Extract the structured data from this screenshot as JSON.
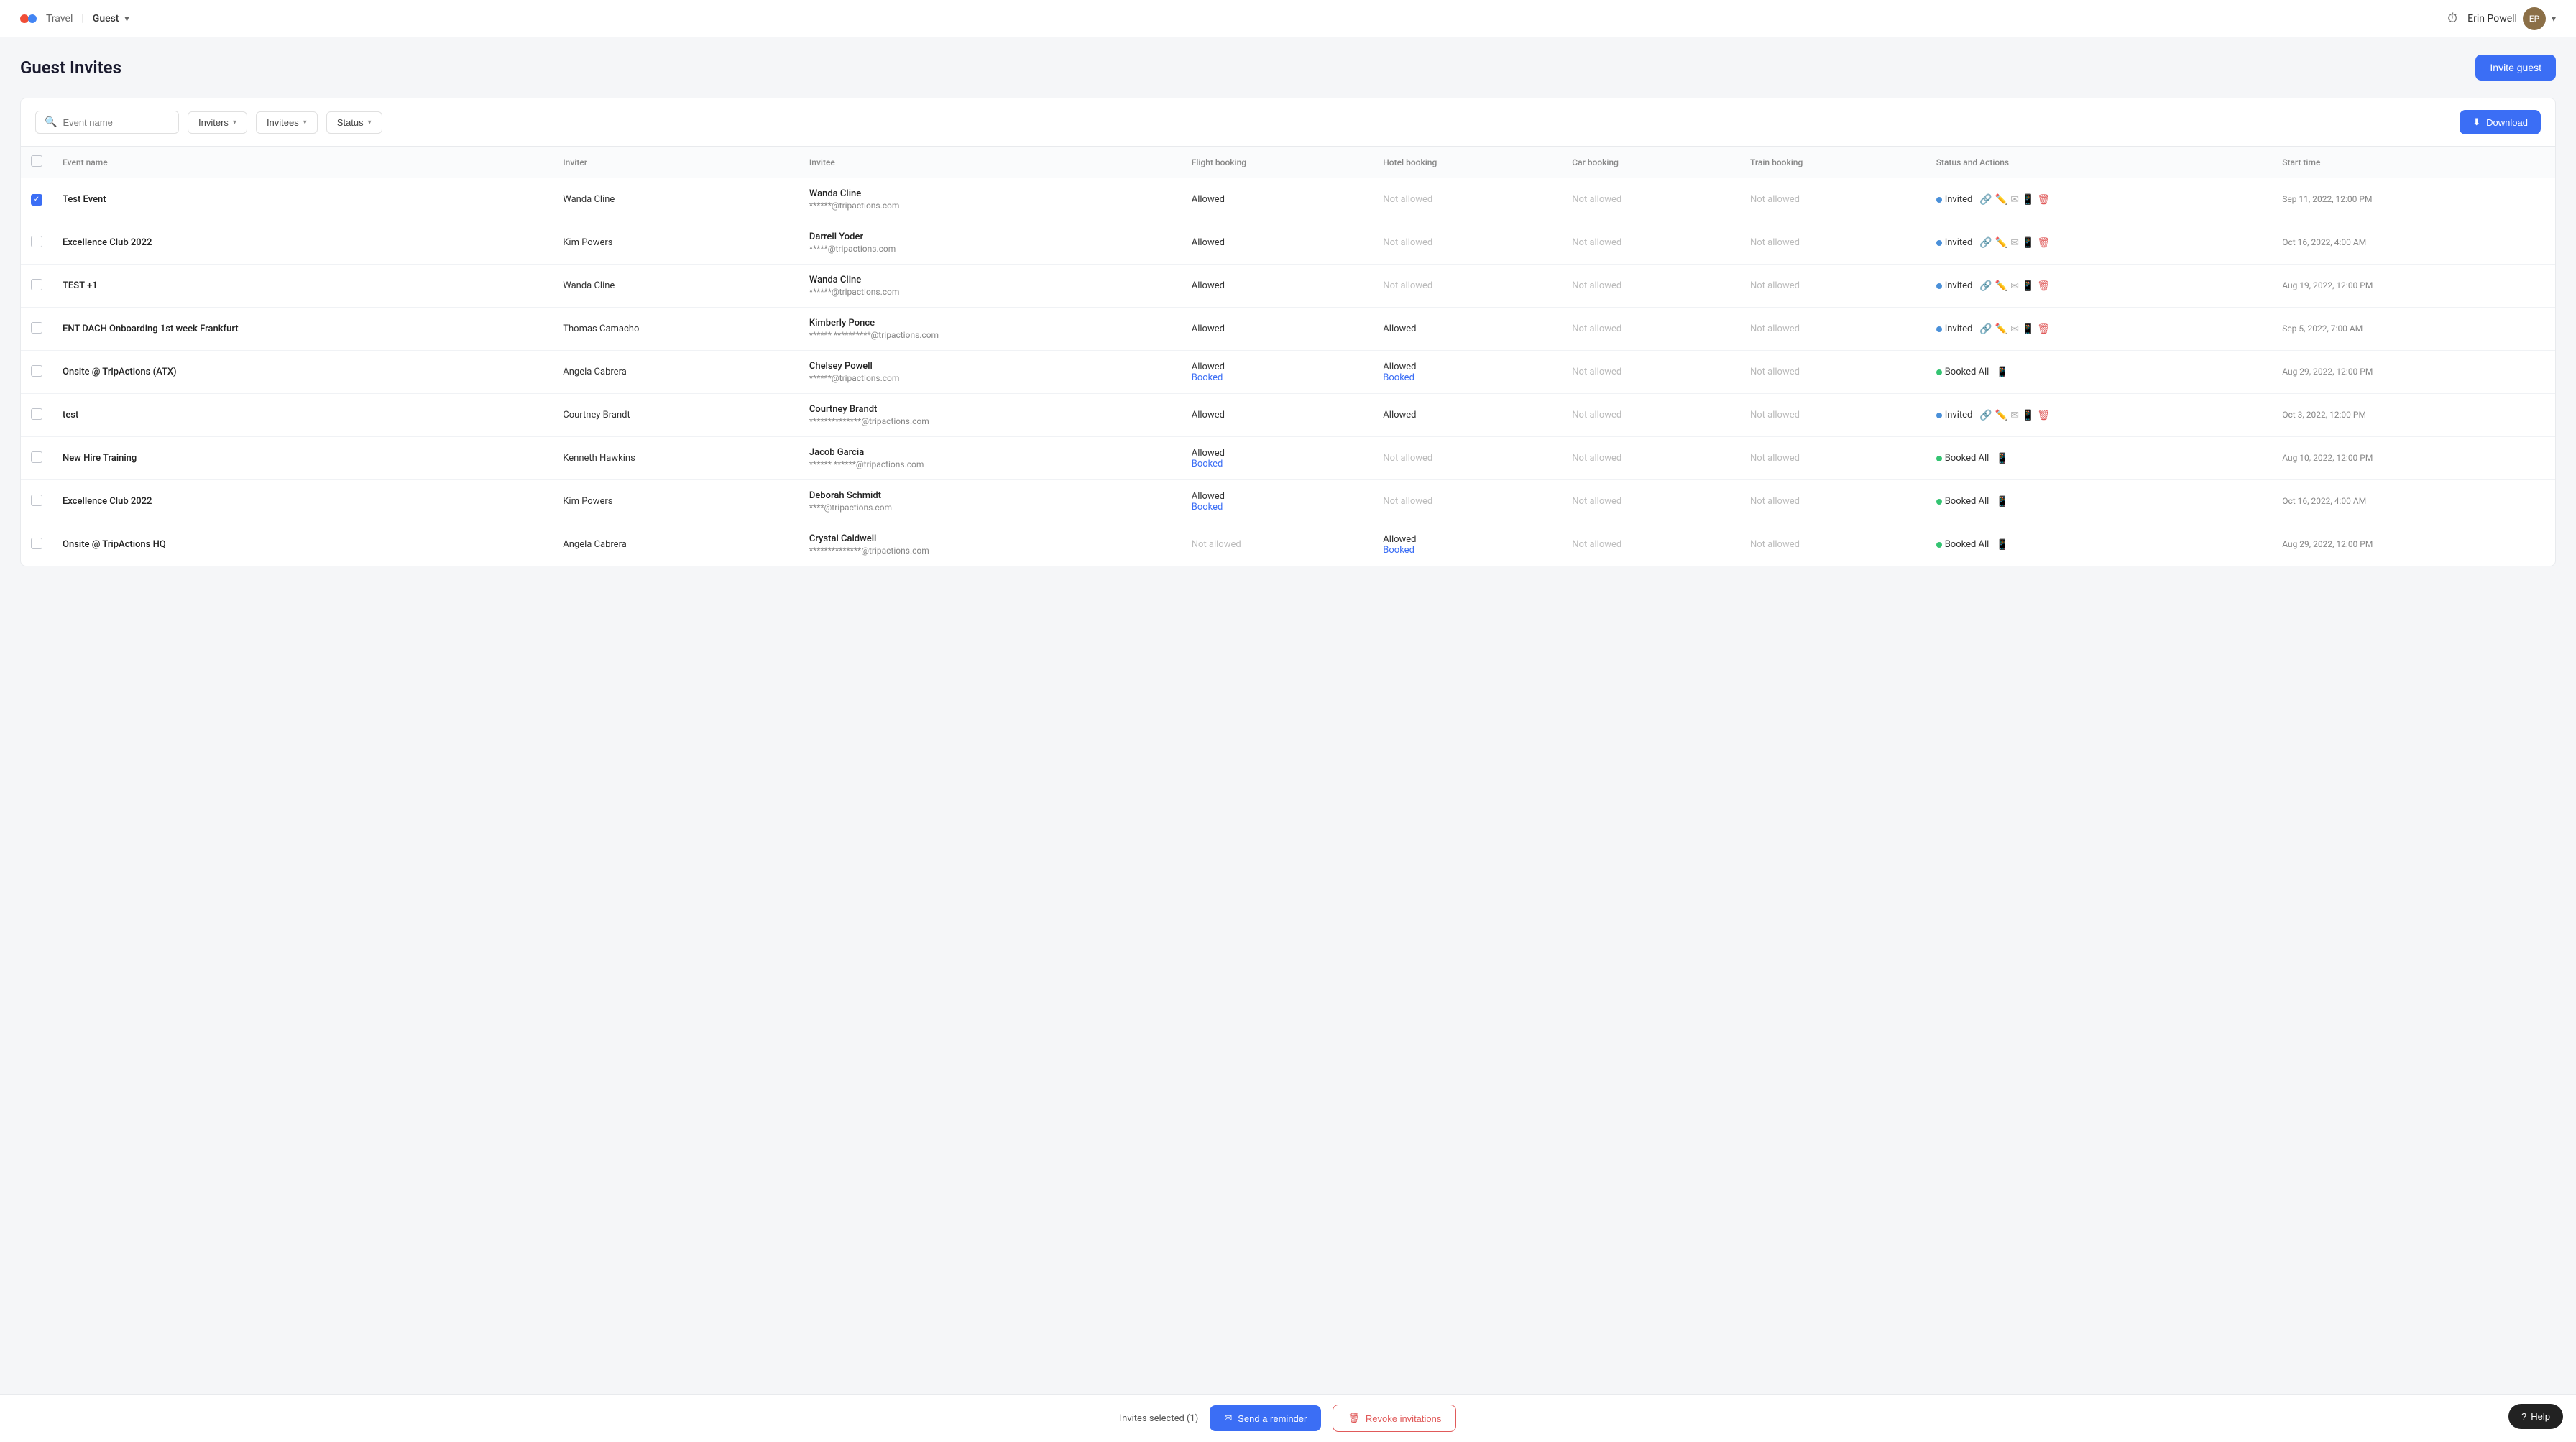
{
  "header": {
    "app_name": "Travel",
    "separator": "|",
    "section": "Guest",
    "dropdown_icon": "▾",
    "user_name": "Erin Powell",
    "clock_icon": "⏱"
  },
  "page": {
    "title": "Guest Invites",
    "invite_button": "Invite guest"
  },
  "filters": {
    "search_placeholder": "Event name",
    "inviters_label": "Inviters",
    "invitees_label": "Invitees",
    "status_label": "Status",
    "download_label": "Download"
  },
  "table": {
    "columns": [
      "Event name",
      "Inviter",
      "Invitee",
      "Flight booking",
      "Hotel booking",
      "Car booking",
      "Train booking",
      "Status and Actions",
      "Start time"
    ],
    "rows": [
      {
        "id": 1,
        "checked": true,
        "event_name": "Test Event",
        "inviter": "Wanda Cline",
        "invitee_name": "Wanda Cline",
        "invitee_email": "******@tripactions.com",
        "flight": "Allowed",
        "hotel": "Not allowed",
        "car": "Not allowed",
        "train": "Not allowed",
        "status": "Invited",
        "status_type": "invited",
        "start_time": "Sep 11, 2022, 12:00 PM",
        "has_actions": true
      },
      {
        "id": 2,
        "checked": false,
        "event_name": "Excellence Club 2022",
        "inviter": "Kim Powers",
        "invitee_name": "Darrell Yoder",
        "invitee_email": "*****@tripactions.com",
        "flight": "Allowed",
        "hotel": "Not allowed",
        "car": "Not allowed",
        "train": "Not allowed",
        "status": "Invited",
        "status_type": "invited",
        "start_time": "Oct 16, 2022, 4:00 AM",
        "has_actions": true
      },
      {
        "id": 3,
        "checked": false,
        "event_name": "TEST +1",
        "inviter": "Wanda Cline",
        "invitee_name": "Wanda Cline",
        "invitee_email": "******@tripactions.com",
        "flight": "Allowed",
        "hotel": "Not allowed",
        "car": "Not allowed",
        "train": "Not allowed",
        "status": "Invited",
        "status_type": "invited",
        "start_time": "Aug 19, 2022, 12:00 PM",
        "has_actions": true
      },
      {
        "id": 4,
        "checked": false,
        "event_name": "ENT DACH Onboarding 1st week Frankfurt",
        "inviter": "Thomas Camacho",
        "invitee_name": "Kimberly Ponce",
        "invitee_email": "****** **********@tripactions.com",
        "flight": "Allowed",
        "hotel": "Allowed",
        "car": "Not allowed",
        "train": "Not allowed",
        "status": "Invited",
        "status_type": "invited",
        "start_time": "Sep 5, 2022, 7:00 AM",
        "has_actions": true
      },
      {
        "id": 5,
        "checked": false,
        "event_name": "Onsite @ TripActions (ATX)",
        "inviter": "Angela Cabrera",
        "invitee_name": "Chelsey Powell",
        "invitee_email": "******@tripactions.com",
        "flight": "Allowed",
        "flight_booked": true,
        "hotel": "Allowed",
        "hotel_booked": true,
        "car": "Not allowed",
        "train": "Not allowed",
        "status": "Booked All",
        "status_type": "booked",
        "start_time": "Aug 29, 2022, 12:00 PM",
        "has_actions": false
      },
      {
        "id": 6,
        "checked": false,
        "event_name": "test",
        "inviter": "Courtney Brandt",
        "invitee_name": "Courtney Brandt",
        "invitee_email": "**************@tripactions.com",
        "flight": "Allowed",
        "hotel": "Allowed",
        "car": "Not allowed",
        "train": "Not allowed",
        "status": "Invited",
        "status_type": "invited",
        "start_time": "Oct 3, 2022, 12:00 PM",
        "has_actions": true
      },
      {
        "id": 7,
        "checked": false,
        "event_name": "New Hire Training",
        "inviter": "Kenneth Hawkins",
        "invitee_name": "Jacob Garcia",
        "invitee_email": "****** ******@tripactions.com",
        "flight": "Allowed",
        "flight_booked": true,
        "hotel": "Not allowed",
        "car": "Not allowed",
        "train": "Not allowed",
        "status": "Booked All",
        "status_type": "booked",
        "start_time": "Aug 10, 2022, 12:00 PM",
        "has_actions": false
      },
      {
        "id": 8,
        "checked": false,
        "event_name": "Excellence Club 2022",
        "inviter": "Kim Powers",
        "invitee_name": "Deborah Schmidt",
        "invitee_email": "****@tripactions.com",
        "flight": "Allowed",
        "flight_booked": true,
        "hotel": "Not allowed",
        "car": "Not allowed",
        "train": "Not allowed",
        "status": "Booked All",
        "status_type": "booked",
        "start_time": "Oct 16, 2022, 4:00 AM",
        "has_actions": false
      },
      {
        "id": 9,
        "checked": false,
        "event_name": "Onsite @ TripActions HQ",
        "inviter": "Angela Cabrera",
        "invitee_name": "Crystal Caldwell",
        "invitee_email": "**************@tripactions.com",
        "flight": "Not allowed",
        "hotel": "Allowed",
        "hotel_booked": true,
        "car": "Not allowed",
        "train": "Not allowed",
        "status": "Booked All",
        "status_type": "booked",
        "start_time": "Aug 29, 2022, 12:00 PM",
        "has_actions": false
      }
    ]
  },
  "bottom_bar": {
    "selected_text": "Invites selected (1)",
    "reminder_button": "Send a reminder",
    "revoke_button": "Revoke invitations"
  },
  "help_button": "Help"
}
